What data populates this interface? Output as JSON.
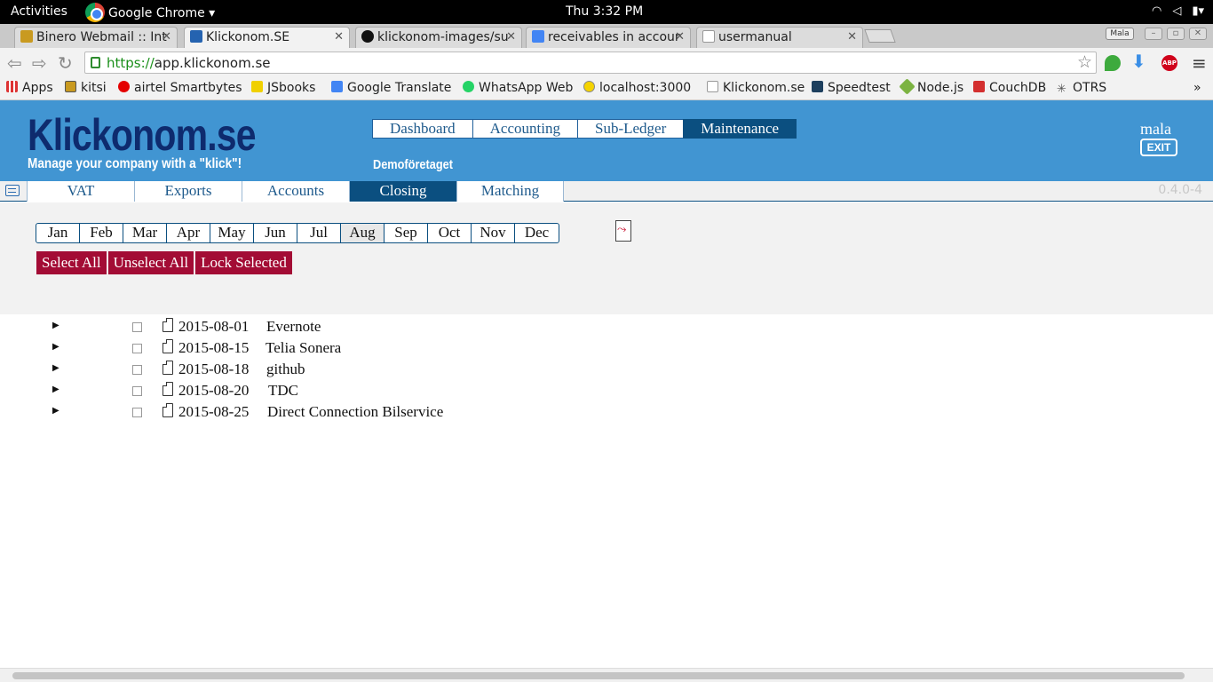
{
  "gnome": {
    "activities": "Activities",
    "app_name": "Google Chrome ▾",
    "clock": "Thu  3:32 PM"
  },
  "browser": {
    "tabs": [
      {
        "title": "Binero Webmail :: Int",
        "color": "#c99a20"
      },
      {
        "title": "Klickonom.SE",
        "color": "#2563b0"
      },
      {
        "title": "klickonom-images/su",
        "color": "#111111"
      },
      {
        "title": "receivables in accour",
        "color": "#4285f4"
      },
      {
        "title": "usermanual",
        "color": "#999999"
      }
    ],
    "profile": "Mala",
    "url_scheme": "https://",
    "url_host": "app.klickonom.se",
    "bookmarks": [
      {
        "label": "Apps"
      },
      {
        "label": "kitsi"
      },
      {
        "label": "airtel Smartbytes"
      },
      {
        "label": "JSbooks"
      },
      {
        "label": "Google Translate"
      },
      {
        "label": "WhatsApp Web"
      },
      {
        "label": "localhost:3000"
      },
      {
        "label": "Klickonom.se"
      },
      {
        "label": "Speedtest"
      },
      {
        "label": "Node.js"
      },
      {
        "label": "CouchDB"
      },
      {
        "label": "OTRS"
      }
    ],
    "bookmarks_more": "»",
    "abp": "ABP"
  },
  "app": {
    "logo": "Klickonom.se",
    "tagline": "Manage your company with a \"klick\"!",
    "main_nav": [
      "Dashboard",
      "Accounting",
      "Sub-Ledger",
      "Maintenance"
    ],
    "company": "Demoföretaget",
    "user": "mala",
    "exit": "EXIT",
    "sub_nav": [
      "VAT",
      "Exports",
      "Accounts",
      "Closing",
      "Matching"
    ],
    "version": "0.4.0-4"
  },
  "closing": {
    "months": [
      "Jan",
      "Feb",
      "Mar",
      "Apr",
      "May",
      "Jun",
      "Jul",
      "Aug",
      "Sep",
      "Oct",
      "Nov",
      "Dec"
    ],
    "selected_month": "Aug",
    "actions": [
      "Select All",
      "Unselect All",
      "Lock Selected"
    ],
    "entries": [
      {
        "date": "2015-08-01",
        "vendor": "Evernote"
      },
      {
        "date": "2015-08-15",
        "vendor": "Telia Sonera"
      },
      {
        "date": "2015-08-18",
        "vendor": "github"
      },
      {
        "date": "2015-08-20",
        "vendor": "TDC"
      },
      {
        "date": "2015-08-25",
        "vendor": "Direct Connection Bilservice"
      }
    ]
  },
  "colors": {
    "header_bg": "#4195d2",
    "nav_active": "#0b4f80",
    "action_btn": "#a30c35"
  }
}
